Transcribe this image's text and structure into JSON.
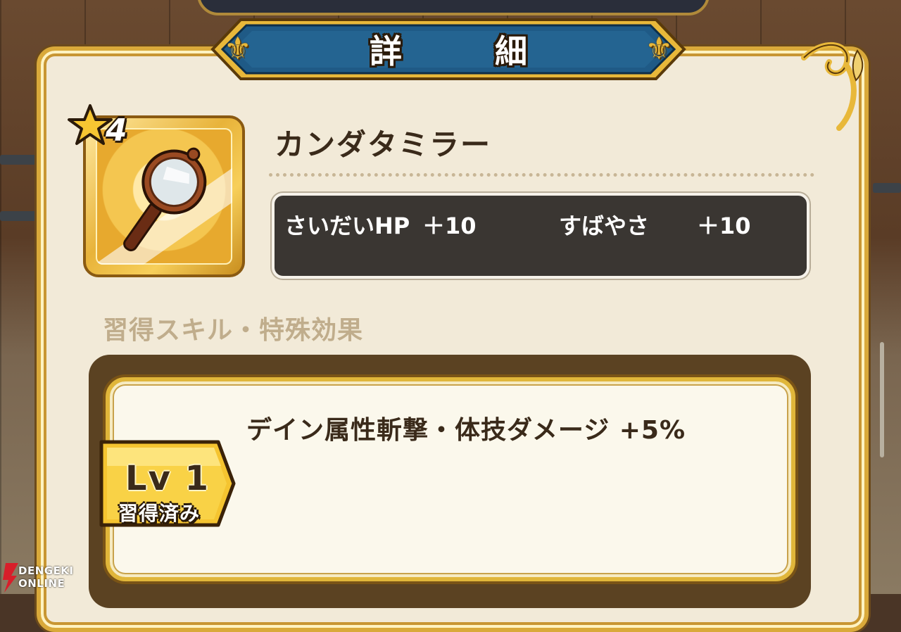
{
  "header": {
    "title": "詳 細"
  },
  "item": {
    "rarity": "4",
    "name": "カンダタミラー",
    "icon": "hand-mirror-icon"
  },
  "stats": [
    {
      "label": "さいだいHP",
      "value": "＋10"
    },
    {
      "label": "すばやさ",
      "value": "＋10"
    }
  ],
  "skills_section": {
    "heading": "習得スキル・特殊効果",
    "skills": [
      {
        "level": "Lv 1",
        "status": "習得済み",
        "effect": "デイン属性斬撃・体技ダメージ +5%"
      }
    ]
  },
  "watermark": {
    "line1": "DENGEKI",
    "line2": "ONLINE"
  },
  "colors": {
    "panel": "#f2ead8",
    "gold": "#d9a93a",
    "banner": "#1f5a86",
    "stats_box": "#3a3632",
    "text_dark": "#3a2a1a"
  }
}
